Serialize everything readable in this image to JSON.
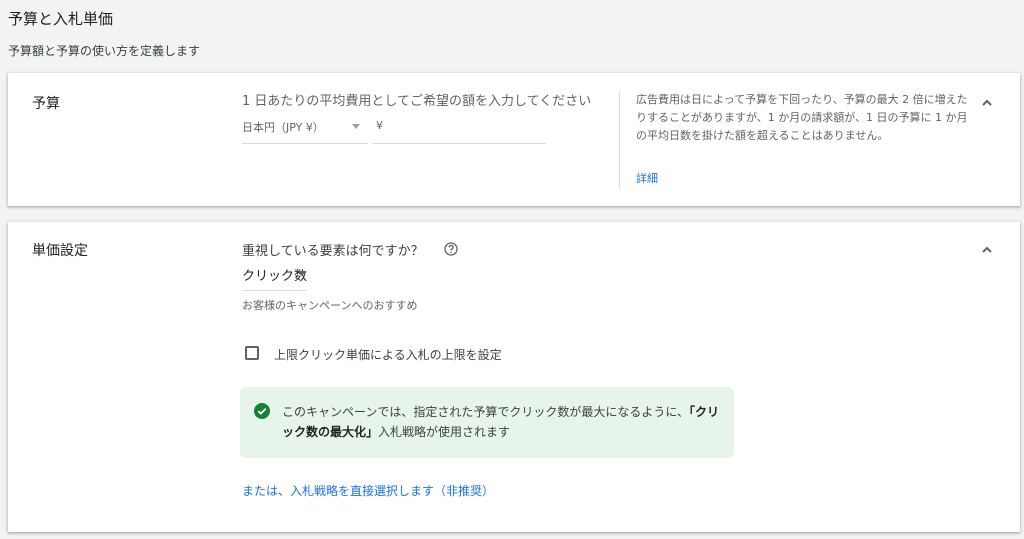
{
  "page": {
    "title": "予算と入札単価",
    "subtitle": "予算額と予算の使い方を定義します"
  },
  "budget": {
    "title": "予算",
    "prompt": "1 日あたりの平均費用としてご希望の額を入力してください",
    "currency_label": "日本円（JPY ¥）",
    "currency_symbol": "¥",
    "amount_value": "",
    "help_text": "広告費用は日によって予算を下回ったり、予算の最大 2 倍に増えたりすることがありますが、1 か月の請求額が、1 日の予算に 1 か月の平均日数を掛けた額を超えることはありません。",
    "help_link": "詳細"
  },
  "bidding": {
    "title": "単価設定",
    "question": "重視している要素は何ですか？",
    "selected_option": "クリック数",
    "recommendation": "お客様のキャンペーンへのおすすめ",
    "checkbox_label": "上限クリック単価による入札の上限を設定",
    "checkbox_checked": false,
    "info": {
      "prefix": "このキャンペーンでは、指定された予算でクリック数が最大になるように、",
      "strategy": "「クリック数の最大化」",
      "suffix": "入札戦略が使用されます"
    },
    "alt_link": "または、入札戦略を直接選択します（非推奨）"
  },
  "icons": {
    "collapse": "chevron-up-icon",
    "help": "help-circle-icon",
    "success": "check-circle-icon"
  },
  "colors": {
    "link": "#1a73e8",
    "success": "#188038",
    "info_bg": "#e6f4ea"
  }
}
